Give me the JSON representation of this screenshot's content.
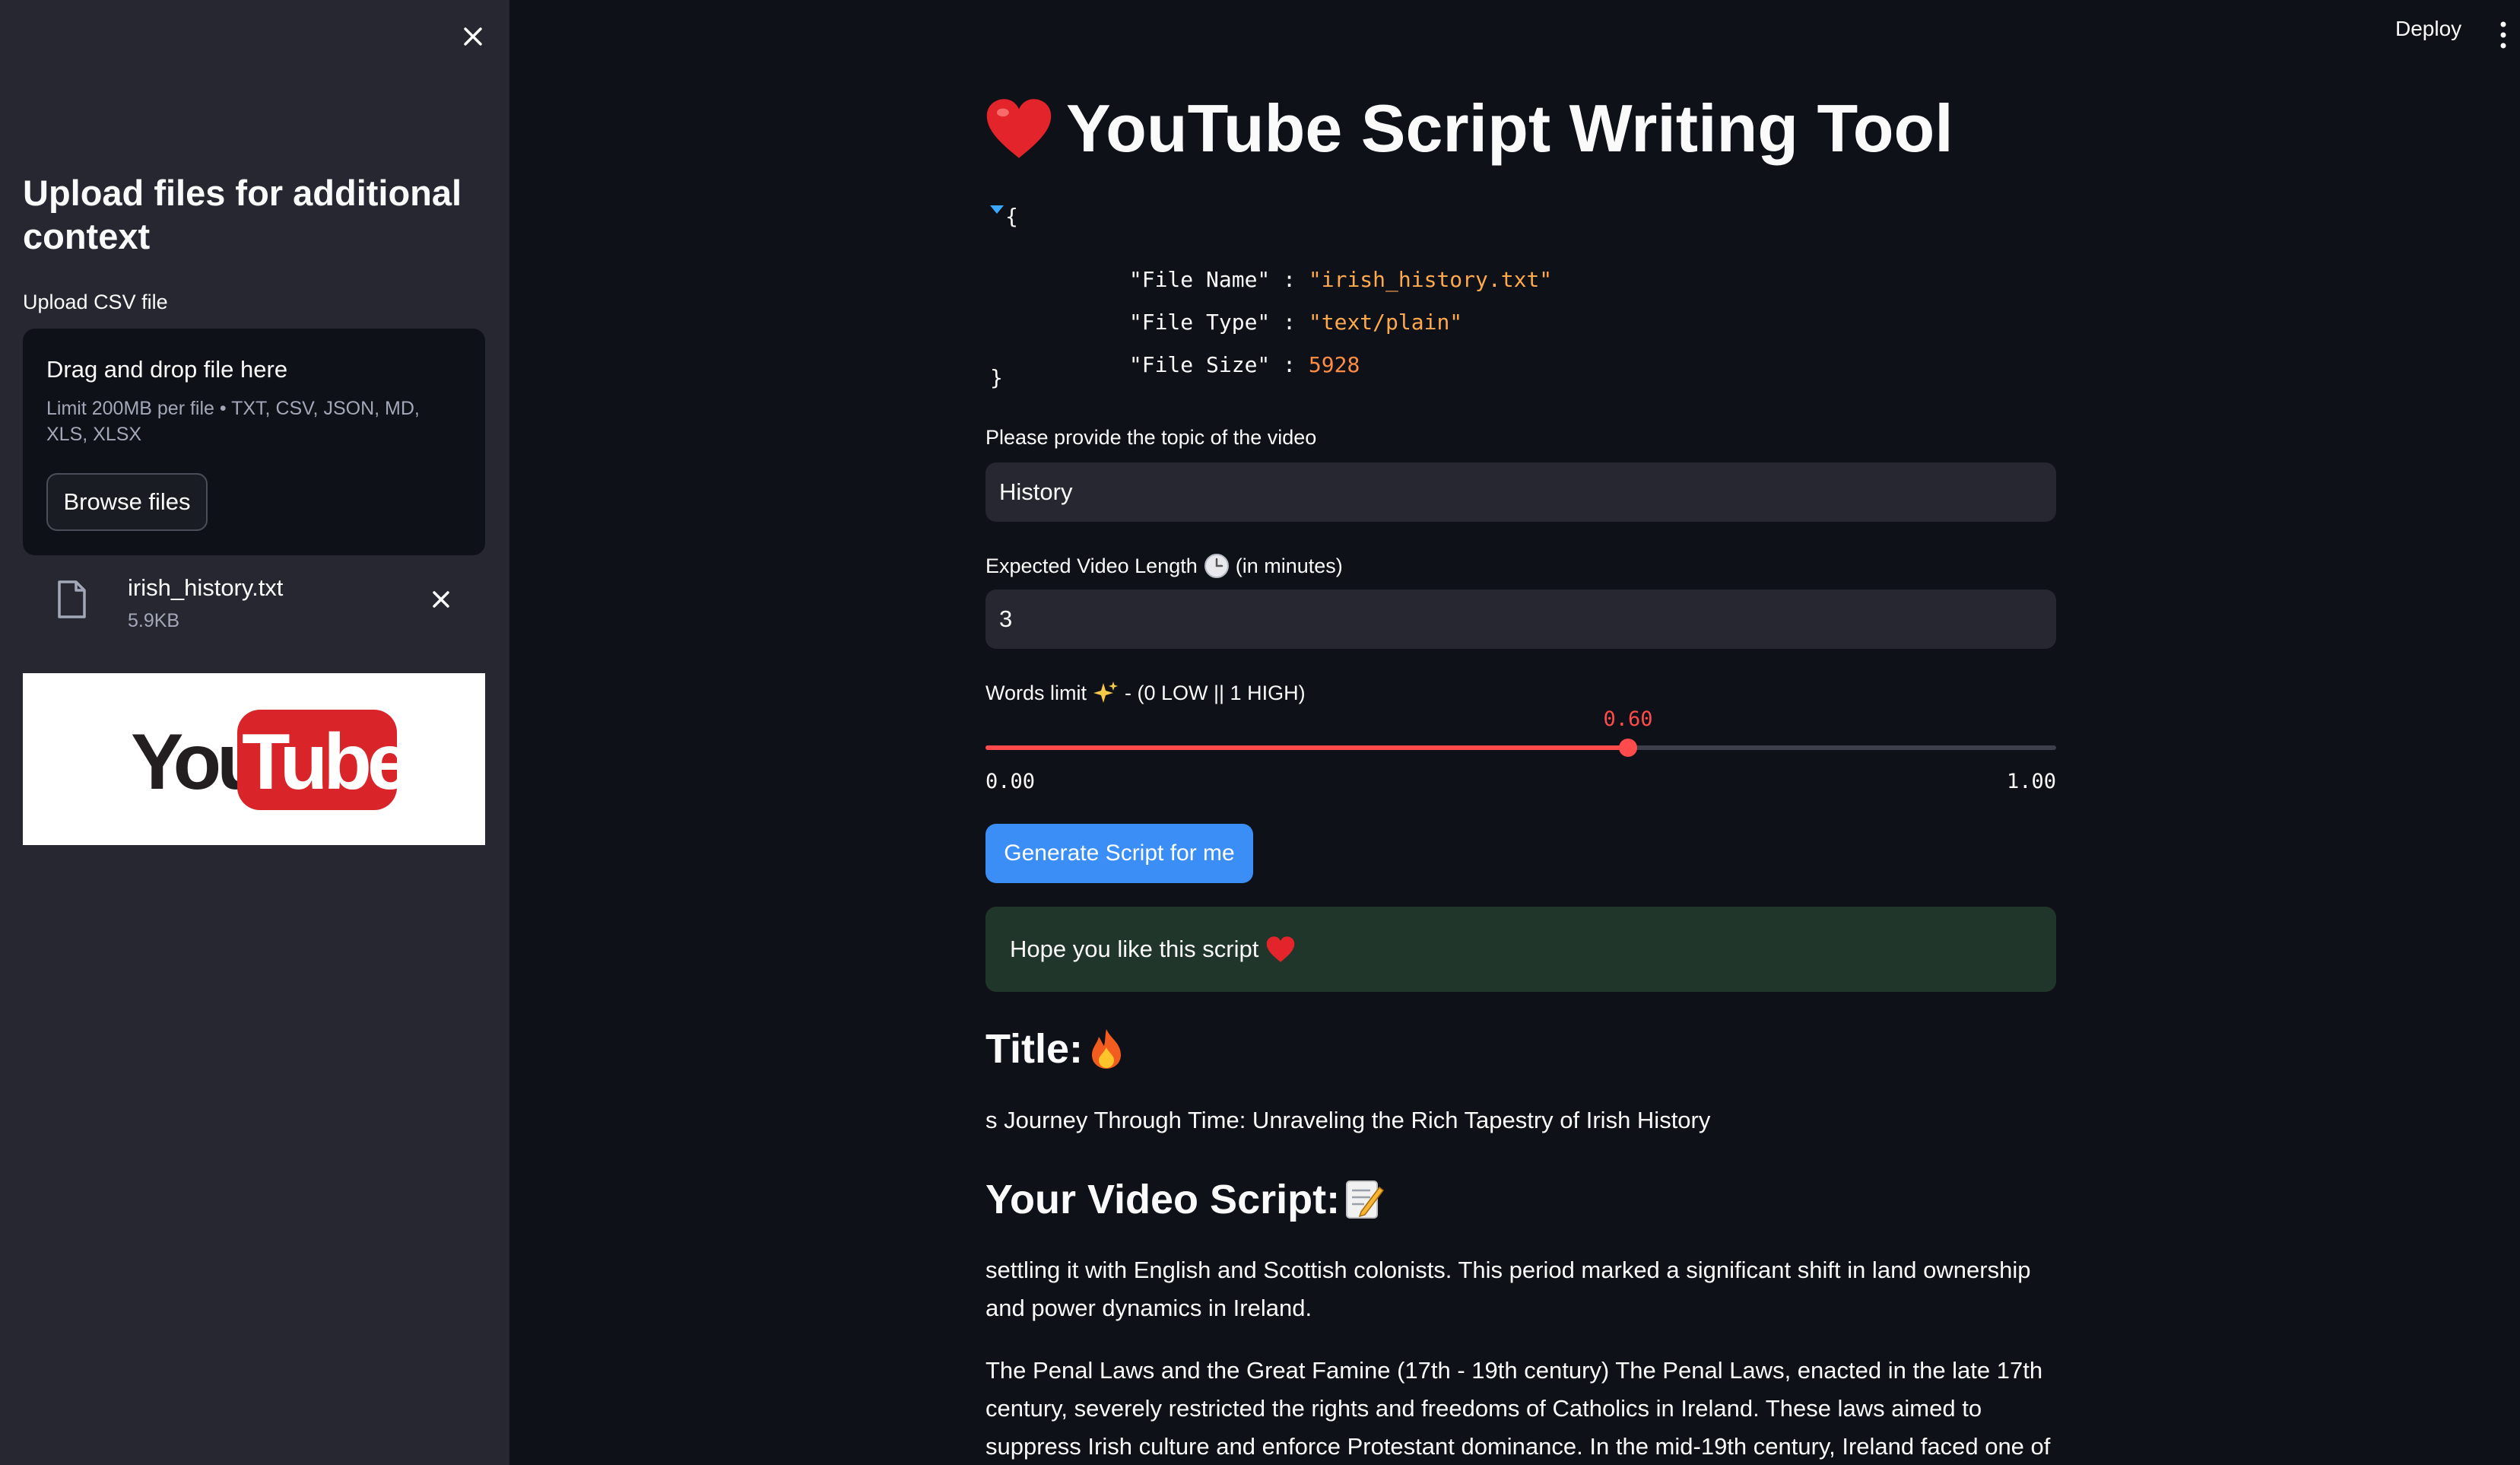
{
  "sidebar": {
    "header": "Upload files for additional context",
    "upload_label": "Upload CSV file",
    "dropzone": {
      "title": "Drag and drop file here",
      "limit": "Limit 200MB per file • TXT, CSV, JSON, MD, XLS, XLSX",
      "browse_label": "Browse files"
    },
    "file": {
      "name": "irish_history.txt",
      "size": "5.9KB"
    },
    "image": {
      "logo_left": "You",
      "logo_right": "Tube"
    },
    "icons": {
      "close": "close-icon",
      "file": "file-icon",
      "remove": "close-icon"
    }
  },
  "topbar": {
    "deploy_label": "Deploy",
    "menu_icon": "vertical-dots-icon"
  },
  "main": {
    "title": "YouTube Script Writing Tool",
    "title_icon": "heart-emoji",
    "json_view": {
      "open_brace": "{",
      "close_brace": "}",
      "entries": [
        {
          "key": "\"File Name\"",
          "value": "\"irish_history.txt\""
        },
        {
          "key": "\"File Type\"",
          "value": "\"text/plain\""
        },
        {
          "key": "\"File Size\"",
          "value": "5928"
        }
      ]
    },
    "topic": {
      "label": "Please provide the topic of the video",
      "value": "History"
    },
    "length": {
      "label_prefix": "Expected Video Length",
      "label_suffix": "(in minutes)",
      "icon": "clock-emoji",
      "value": "3"
    },
    "words_limit": {
      "label_prefix": "Words limit",
      "label_suffix": "- (0 LOW || 1 HIGH)",
      "icon": "sparkles-emoji",
      "value": 0.6,
      "value_label": "0.60",
      "min_label": "0.00",
      "max_label": "1.00"
    },
    "generate_label": "Generate Script for me",
    "success_message": "Hope you like this script",
    "title_heading": "Title:",
    "title_heading_icon": "fire-emoji",
    "title_text": "s Journey Through Time: Unraveling the Rich Tapestry of Irish History",
    "script_heading": "Your Video Script:",
    "script_heading_icon": "memo-emoji",
    "script_paragraph_1": "settling it with English and Scottish colonists. This period marked a significant shift in land ownership and power dynamics in Ireland.",
    "script_paragraph_2": "The Penal Laws and the Great Famine (17th - 19th century) The Penal Laws, enacted in the late 17th century, severely restricted the rights and freedoms of Catholics in Ireland. These laws aimed to suppress Irish culture and enforce Protestant dominance. In the mid-19th century, Ireland faced one of its most"
  },
  "colors": {
    "sidebar_bg": "#262730",
    "app_bg": "#0e1117",
    "accent_red": "#ff4b4b",
    "button_blue": "#3a8ef6",
    "success_bg": "#21362b",
    "json_string": "#ffa94d"
  }
}
